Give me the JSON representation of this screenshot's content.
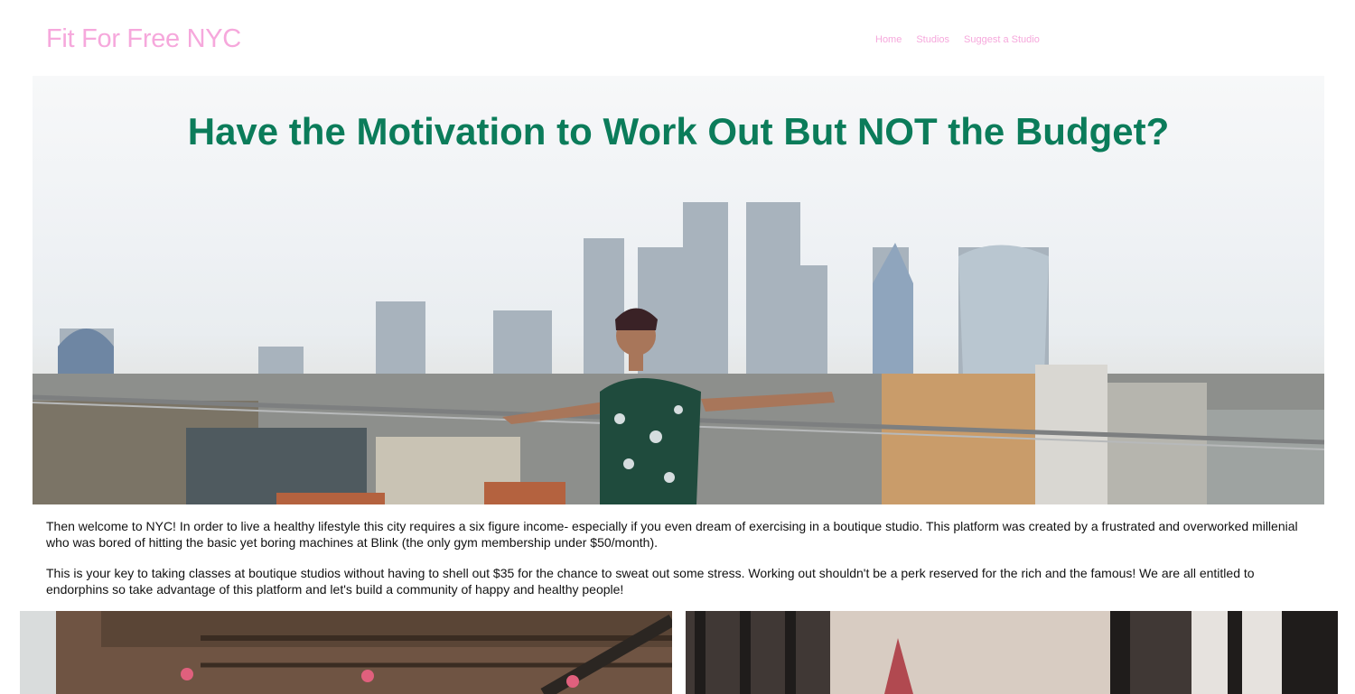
{
  "brand": "Fit For Free NYC",
  "nav": {
    "items": [
      {
        "label": "Home"
      },
      {
        "label": "Studios"
      },
      {
        "label": "Suggest a Studio"
      }
    ]
  },
  "hero": {
    "title": "Have the Motivation to Work Out But NOT the Budget?"
  },
  "intro": {
    "paragraph1": "Then welcome to NYC! In order to live a healthy lifestyle this city requires a six figure income- especially if you even dream of exercising in a boutique studio. This platform was created by a frustrated and overworked millenial who was bored of hitting the basic yet boring machines at Blink (the only gym membership under $50/month).",
    "paragraph2": "This is your key to taking classes at boutique studios without having to shell out $35 for the chance to sweat out some stress. Working out shouldn't be a perk reserved for the rich and the famous! We are all entitled to endorphins so take advantage of this platform and let's build a community of happy and healthy people!"
  },
  "colors": {
    "brand_pink": "#f6a8dc",
    "hero_green": "#0b7c5a",
    "body_text": "#111111"
  }
}
